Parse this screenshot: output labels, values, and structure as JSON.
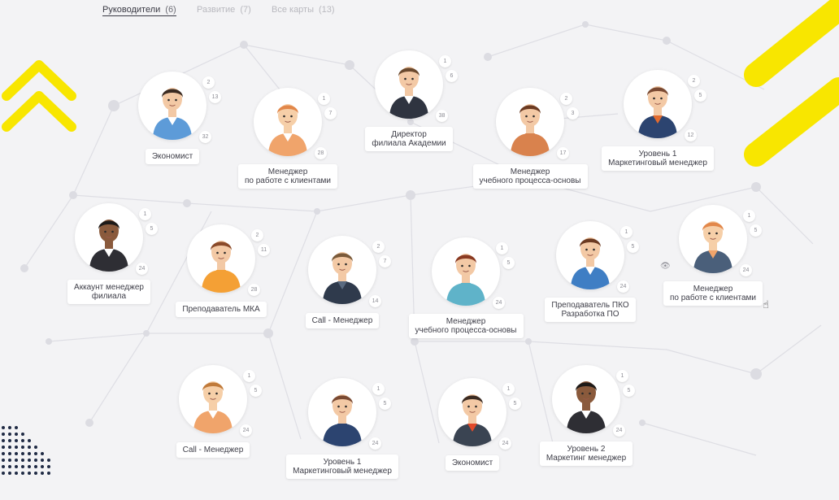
{
  "tabs": [
    {
      "label": "Руководители",
      "count": "(6)"
    },
    {
      "label": "Развитие",
      "count": "(7)"
    },
    {
      "label": "Все карты",
      "count": "(13)"
    }
  ],
  "cards": [
    {
      "title": "Экономист",
      "badges": [
        "2",
        "13",
        "32"
      ],
      "avatar": {
        "skin": "#f3c9a5",
        "hair": "#3b2b22",
        "clothes": "#5d9bd8",
        "accent": "#ffffff"
      }
    },
    {
      "title": "Менеджер\nпо работе с клиентами",
      "badges": [
        "1",
        "7",
        "28"
      ],
      "avatar": {
        "skin": "#f6cfa8",
        "hair": "#e2874a",
        "clothes": "#f0a46b",
        "accent": "#ffffff"
      }
    },
    {
      "title": "Директор\nфилиала Академии",
      "badges": [
        "1",
        "6",
        "38"
      ],
      "avatar": {
        "skin": "#f3c9a5",
        "hair": "#6b4a2f",
        "clothes": "#2f3440",
        "accent": "#ffffff"
      }
    },
    {
      "title": "Менеджер\nучебного процесса-основы",
      "badges": [
        "2",
        "3",
        "17"
      ],
      "avatar": {
        "skin": "#f3c9a5",
        "hair": "#6b3a22",
        "clothes": "#d9824d",
        "accent": "#d9824d"
      }
    },
    {
      "title": "Уровень 1\nМаркетинговый менеджер",
      "badges": [
        "2",
        "5",
        "12"
      ],
      "avatar": {
        "skin": "#f3c9a5",
        "hair": "#7a4a33",
        "clothes": "#2c4470",
        "accent": "#e26b2f"
      }
    },
    {
      "title": "Аккаунт менеджер\nфилиала",
      "badges": [
        "1",
        "5",
        "24"
      ],
      "avatar": {
        "skin": "#8a5a3c",
        "hair": "#1e1a18",
        "clothes": "#2e2e34",
        "accent": "#ffffff"
      }
    },
    {
      "title": "Преподаватель МКА",
      "badges": [
        "2",
        "11",
        "28"
      ],
      "avatar": {
        "skin": "#f3c9a5",
        "hair": "#8a4a2a",
        "clothes": "#f4a035",
        "accent": "#f4a035"
      }
    },
    {
      "title": "Call - Менеджер",
      "badges": [
        "2",
        "7",
        "14"
      ],
      "avatar": {
        "skin": "#f3c9a5",
        "hair": "#7a5a3a",
        "clothes": "#2f3a4c",
        "accent": "#5a6a80"
      }
    },
    {
      "title": "Менеджер\nучебного процесса-основы",
      "badges": [
        "1",
        "5",
        "24"
      ],
      "avatar": {
        "skin": "#f3c9a5",
        "hair": "#8a3a22",
        "clothes": "#5fb3c9",
        "accent": "#5fb3c9"
      }
    },
    {
      "title": "Преподаватель ПКО\nРазработка ПО",
      "badges": [
        "1",
        "5",
        "24"
      ],
      "avatar": {
        "skin": "#f3c9a5",
        "hair": "#6b3a22",
        "clothes": "#3f7ec4",
        "accent": "#ffffff"
      }
    },
    {
      "title": "Менеджер\nпо работе с клиентами",
      "badges": [
        "1",
        "5",
        "24"
      ],
      "avatar": {
        "skin": "#f6cfa8",
        "hair": "#e2874a",
        "clothes": "#4a5f7a",
        "accent": "#f0a46b"
      }
    },
    {
      "title": "Call - Менеджер",
      "badges": [
        "1",
        "5",
        "24"
      ],
      "avatar": {
        "skin": "#f6cfa8",
        "hair": "#c07a3a",
        "clothes": "#f0a46b",
        "accent": "#ffffff"
      }
    },
    {
      "title": "Уровень 1\nМаркетинговый менеджер",
      "badges": [
        "1",
        "5",
        "24"
      ],
      "avatar": {
        "skin": "#f3c9a5",
        "hair": "#7a4a33",
        "clothes": "#2c4470",
        "accent": "#2c4470"
      }
    },
    {
      "title": "Экономист",
      "badges": [
        "1",
        "5",
        "24"
      ],
      "avatar": {
        "skin": "#f3c9a5",
        "hair": "#3b2b22",
        "clothes": "#3a4452",
        "accent": "#e24a2a"
      }
    },
    {
      "title": "Уровень 2\nМаркетинг менеджер",
      "badges": [
        "1",
        "5",
        "24"
      ],
      "avatar": {
        "skin": "#8a5a3c",
        "hair": "#1e1a18",
        "clothes": "#2e2e34",
        "accent": "#ffffff"
      }
    }
  ],
  "colors": {
    "yellow": "#f8e600",
    "navy": "#1f2a44",
    "network": "#dcdce2"
  }
}
